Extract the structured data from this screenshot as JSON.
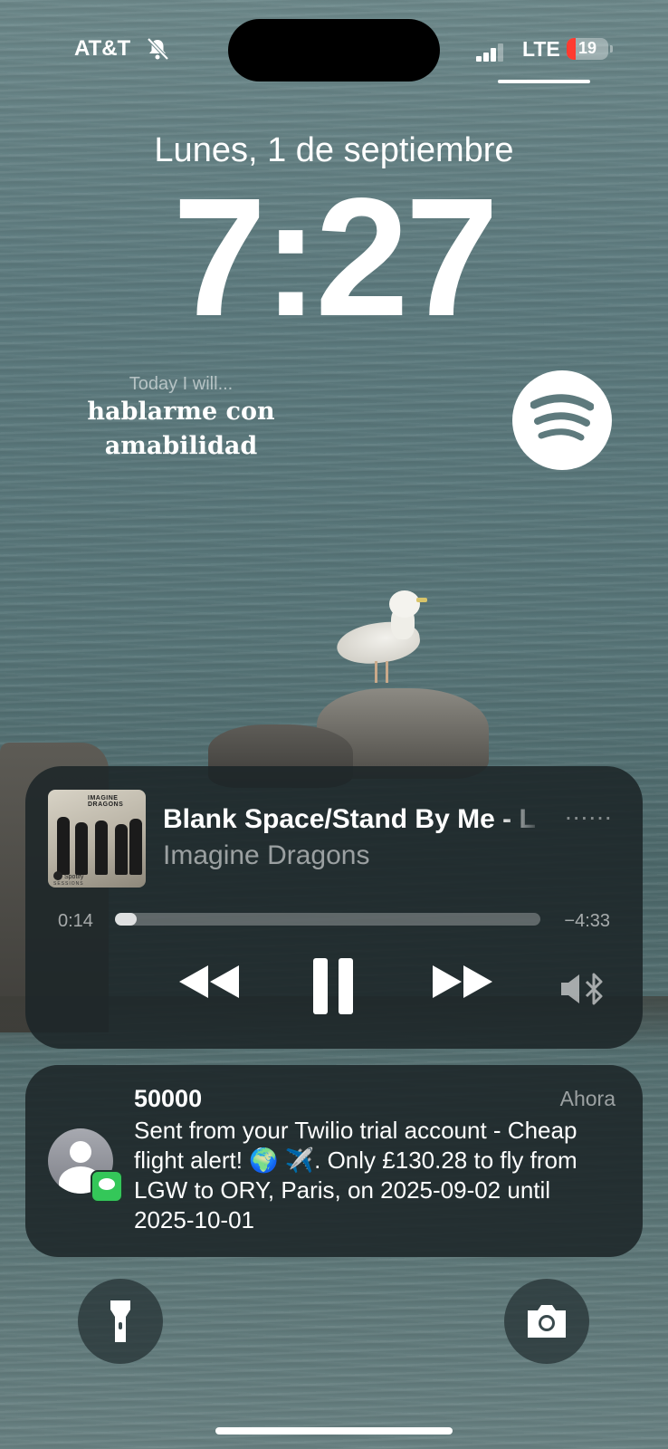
{
  "status_bar": {
    "carrier": "AT&T",
    "network": "LTE",
    "battery": "19"
  },
  "lock_screen": {
    "date": "Lunes, 1 de septiembre",
    "time": "7:27"
  },
  "widget": {
    "caption": "Today I will...",
    "text": "hablarme con amabilidad"
  },
  "now_playing": {
    "title": "Blank Space/Stand By Me - L",
    "dots": "......",
    "artist": "Imagine Dragons",
    "elapsed": "0:14",
    "remaining": "−4:33",
    "progress_fraction": 0.05,
    "album_art_text": "IMAGINE DRAGONS",
    "album_art_label": "Spotify",
    "album_art_sessions": "SESSIONS"
  },
  "notification": {
    "sender": "50000",
    "time": "Ahora",
    "body": "Sent from your Twilio trial account - Cheap flight alert! 🌍 ✈️. Only £130.28 to fly from LGW to ORY, Paris, on 2025-09-02 until 2025-10-01"
  },
  "icons": {
    "bell": "bell-slash-icon",
    "spotify": "spotify-icon",
    "flashlight": "flashlight-icon",
    "camera": "camera-icon",
    "airplay": "speaker-bluetooth-icon"
  },
  "colors": {
    "battery_low": "#ff3b30",
    "messages_green": "#34c759"
  }
}
